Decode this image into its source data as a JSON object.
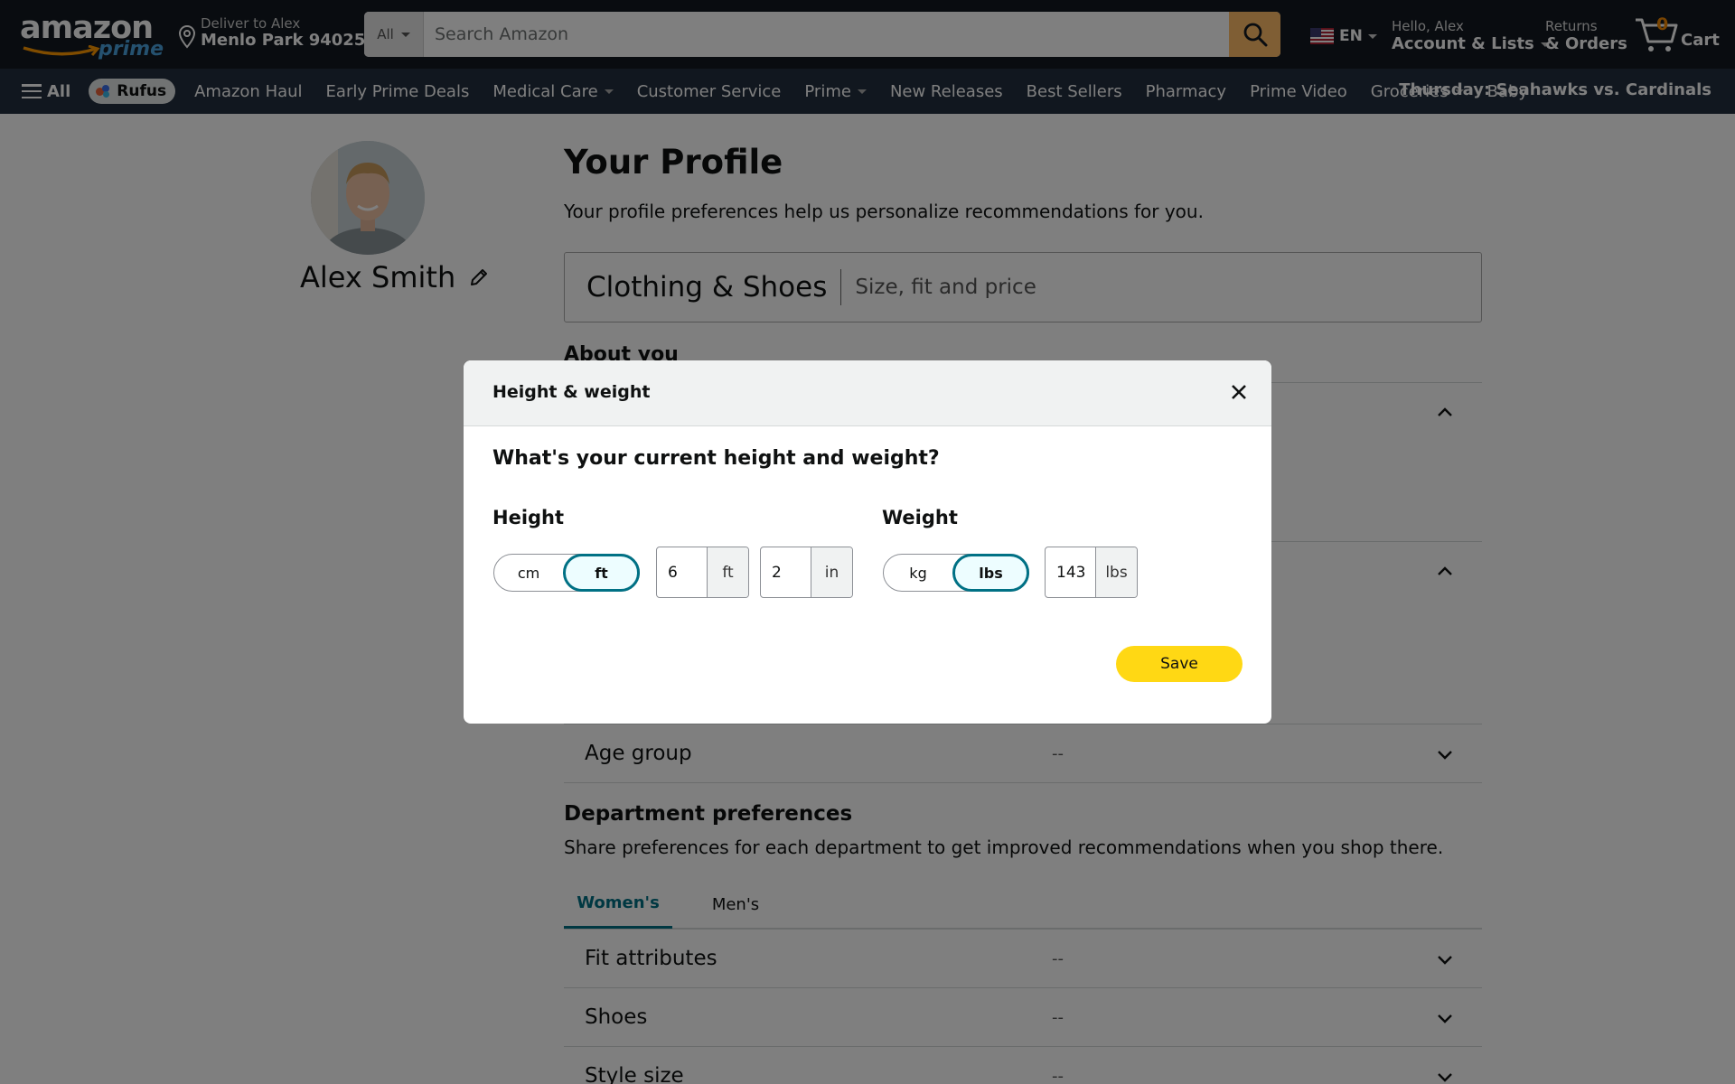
{
  "header": {
    "logo": {
      "word": "amazon",
      "prime": "prime"
    },
    "deliver": {
      "line1": "Deliver to Alex",
      "line2": "Menlo Park 94025"
    },
    "search": {
      "category": "All",
      "placeholder": "Search Amazon"
    },
    "language": "EN",
    "account": {
      "line1": "Hello, Alex",
      "line2": "Account & Lists"
    },
    "returns": {
      "line1": "Returns",
      "line2": "& Orders"
    },
    "cart": {
      "count": "0",
      "label": "Cart"
    }
  },
  "subnav": {
    "all_label": "All",
    "rufus_label": "Rufus",
    "links": [
      {
        "label": "Amazon Haul",
        "dropdown": false
      },
      {
        "label": "Early Prime Deals",
        "dropdown": false
      },
      {
        "label": "Medical Care",
        "dropdown": true
      },
      {
        "label": "Customer Service",
        "dropdown": false
      },
      {
        "label": "Prime",
        "dropdown": true
      },
      {
        "label": "New Releases",
        "dropdown": false
      },
      {
        "label": "Best Sellers",
        "dropdown": false
      },
      {
        "label": "Pharmacy",
        "dropdown": false
      },
      {
        "label": "Prime Video",
        "dropdown": false
      },
      {
        "label": "Groceries",
        "dropdown": true
      },
      {
        "label": "Baby",
        "dropdown": false
      }
    ],
    "promo": "Thursday: Seahawks vs. Cardinals"
  },
  "profile": {
    "name": "Alex Smith",
    "title": "Your Profile",
    "subtitle": "Your profile preferences help us personalize recommendations for you.",
    "card": {
      "category": "Clothing & Shoes",
      "description": "Size, fit and price"
    },
    "about_heading": "About you",
    "rows": {
      "age_group": {
        "label": "Age group",
        "value": "--"
      }
    },
    "department": {
      "title": "Department preferences",
      "subtitle": "Share preferences for each department to get improved recommendations when you shop there.",
      "tabs": [
        "Women's",
        "Men's"
      ],
      "active_tab": "Women's",
      "rows": [
        {
          "label": "Fit attributes",
          "value": "--"
        },
        {
          "label": "Shoes",
          "value": "--"
        },
        {
          "label": "Style size",
          "value": "--"
        }
      ]
    }
  },
  "modal": {
    "title": "Height & weight",
    "question": "What's your current height and weight?",
    "height": {
      "label": "Height",
      "unit_options": [
        "cm",
        "ft"
      ],
      "selected_unit": "ft",
      "feet_value": "6",
      "feet_unit": "ft",
      "inches_value": "2",
      "inches_unit": "in"
    },
    "weight": {
      "label": "Weight",
      "unit_options": [
        "kg",
        "lbs"
      ],
      "selected_unit": "lbs",
      "value": "143",
      "unit": "lbs"
    },
    "save_label": "Save"
  },
  "colors": {
    "nav_dark": "#131921",
    "nav_sub": "#232f3e",
    "search_button": "#febd69",
    "cart_count": "#f08804",
    "accent_teal": "#007185",
    "save_yellow": "#ffd814"
  }
}
